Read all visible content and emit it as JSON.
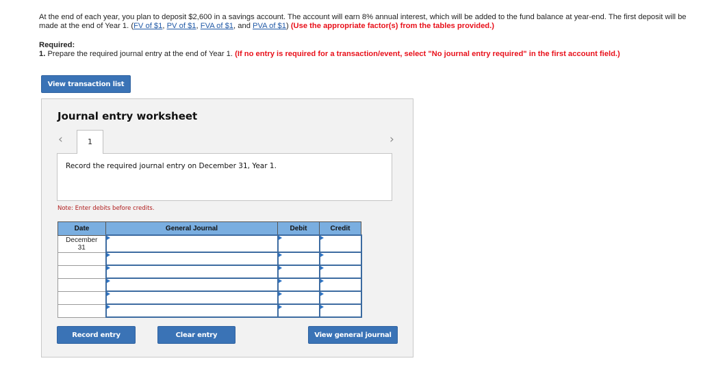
{
  "problem": {
    "text_1": "At the end of each year, you plan to deposit $2,600 in a savings account. The account will earn 8% annual interest, which will be added to the fund balance at year-end. The first deposit will be made at the end of Year 1. (",
    "links": [
      "FV of $1",
      "PV of $1",
      "FVA of $1",
      "PVA of $1"
    ],
    "sep_1": ", ",
    "sep_2": ", ",
    "sep_3": ", and ",
    "close_paren": ") ",
    "instruction": "(Use the appropriate factor(s) from the tables provided.)"
  },
  "required": {
    "heading": "Required:",
    "item_number": "1.",
    "item_text": " Prepare the required journal entry at the end of Year 1. ",
    "item_instruction": "(If no entry is required for a transaction/event, select \"No journal entry required\" in the first account field.)"
  },
  "buttons": {
    "view_transaction_list": "View transaction list",
    "record_entry": "Record entry",
    "clear_entry": "Clear entry",
    "view_general_journal": "View general journal"
  },
  "worksheet": {
    "title": "Journal entry worksheet",
    "prev_icon": "‹",
    "next_icon": "›",
    "active_tab": "1",
    "instruction": "Record the required journal entry on December 31, Year 1.",
    "note": "Note: Enter debits before credits."
  },
  "journal": {
    "headers": {
      "date": "Date",
      "general_journal": "General Journal",
      "debit": "Debit",
      "credit": "Credit"
    },
    "rows": [
      {
        "date": "December 31",
        "account": "",
        "debit": "",
        "credit": ""
      },
      {
        "date": "",
        "account": "",
        "debit": "",
        "credit": ""
      },
      {
        "date": "",
        "account": "",
        "debit": "",
        "credit": ""
      },
      {
        "date": "",
        "account": "",
        "debit": "",
        "credit": ""
      },
      {
        "date": "",
        "account": "",
        "debit": "",
        "credit": ""
      },
      {
        "date": "",
        "account": "",
        "debit": "",
        "credit": ""
      }
    ]
  },
  "colors": {
    "button_blue": "#3a73b6",
    "header_blue": "#7aaee0",
    "instruction_red": "#e8101a",
    "link_blue": "#1f58a6"
  }
}
